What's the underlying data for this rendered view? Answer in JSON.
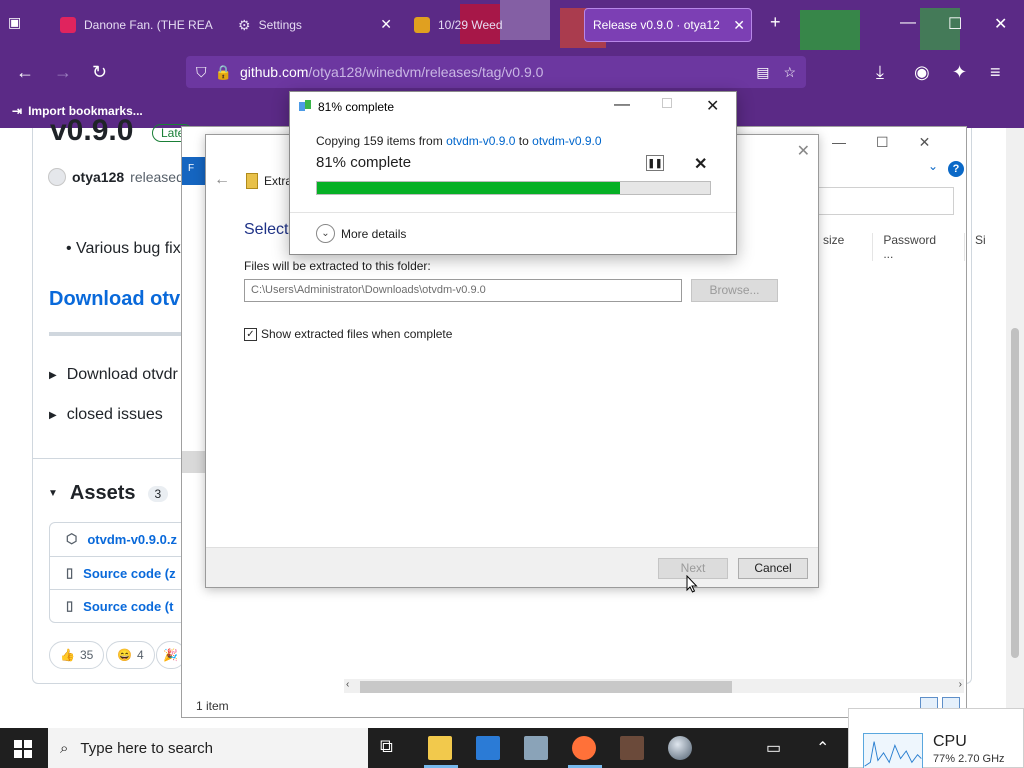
{
  "browser": {
    "tabs": [
      {
        "label": "Danone Fan. (THE REA",
        "color": "#e0245e"
      },
      {
        "label": "Settings",
        "color": ""
      },
      {
        "label": "10/29 Weed",
        "color": "#e0a020"
      },
      {
        "label": "Release v0.9.0 · otya12",
        "color": "#1f1f1f"
      }
    ],
    "url_host": "github.com",
    "url_path": "/otya128/winedvm/releases/tag/v0.9.0",
    "bookmarks_label": "Import bookmarks...",
    "accent": "#5b2a86"
  },
  "github": {
    "title": "v0.9.0",
    "latest_badge": "Late",
    "author": "otya128",
    "released": "released",
    "bullet": "Various bug fix",
    "download_heading": "Download otvd",
    "details": [
      "Download otvdr",
      "closed issues"
    ],
    "assets_label": "Assets",
    "assets_count": "3",
    "assets": [
      "otvdm-v0.9.0.z",
      "Source code (z",
      "Source code (t"
    ],
    "reactions": [
      {
        "icon": "thumbs-up",
        "count": "35"
      },
      {
        "icon": "smile",
        "count": "4"
      }
    ]
  },
  "explorer": {
    "columns": [
      "size",
      "Password ...",
      "Si"
    ],
    "status": "1 item"
  },
  "wizard": {
    "title_text": "Extra",
    "heading": "Select",
    "folder_label": "Files will be extracted to this folder:",
    "folder_path": "C:\\Users\\Administrator\\Downloads\\otvdm-v0.9.0",
    "browse_label": "Browse...",
    "checkbox_label": "Show extracted files when complete",
    "checkbox_checked": true,
    "next_label": "Next",
    "cancel_label": "Cancel"
  },
  "copy_dialog": {
    "title": "81% complete",
    "copying_prefix": "Copying 159 items from",
    "source": "otvdm-v0.9.0",
    "to": "to",
    "dest": "otvdm-v0.9.0",
    "percent_text": "81% complete",
    "progress": 0.77,
    "more_details": "More details"
  },
  "taskbar": {
    "search_placeholder": "Type here to search",
    "cpu_title": "CPU",
    "cpu_sub": "77%  2.70 GHz"
  }
}
